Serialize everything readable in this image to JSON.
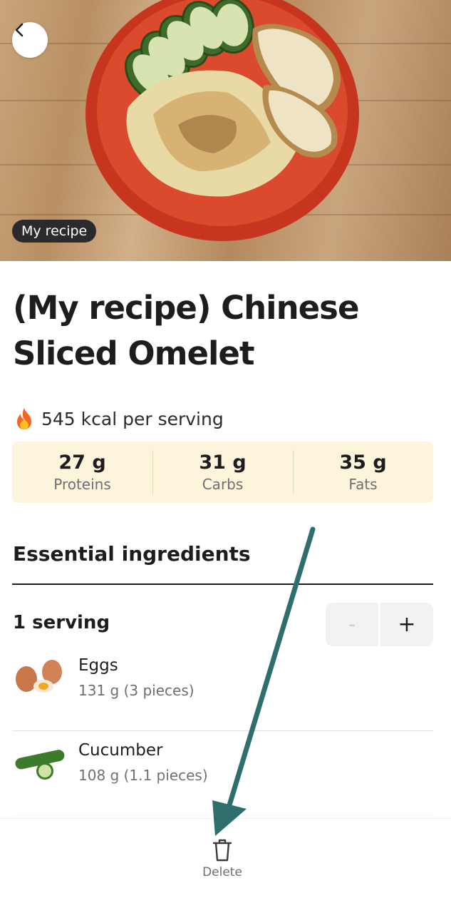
{
  "hero": {
    "badge": "My recipe",
    "back_icon": "chevron-left-icon"
  },
  "recipe": {
    "title": "(My recipe) Chinese Sliced Omelet",
    "kcal_text": "545 kcal per serving",
    "kcal_icon": "flame-icon"
  },
  "macros": [
    {
      "value": "27 g",
      "label": "Proteins"
    },
    {
      "value": "31 g",
      "label": "Carbs"
    },
    {
      "value": "35 g",
      "label": "Fats"
    }
  ],
  "ingredients_section": {
    "title": "Essential ingredients",
    "serving_label": "1 serving",
    "minus_label": "-",
    "plus_label": "+",
    "items": [
      {
        "name": "Eggs",
        "quantity": "131 g (3 pieces)",
        "icon": "eggs-icon"
      },
      {
        "name": "Cucumber",
        "quantity": "108 g (1.1 pieces)",
        "icon": "cucumber-icon"
      }
    ]
  },
  "bottom_bar": {
    "delete_label": "Delete",
    "delete_icon": "trash-icon"
  },
  "colors": {
    "macro_bg": "#fdf4dc",
    "arrow": "#2e6f6e",
    "bowl": "#d9432a"
  }
}
